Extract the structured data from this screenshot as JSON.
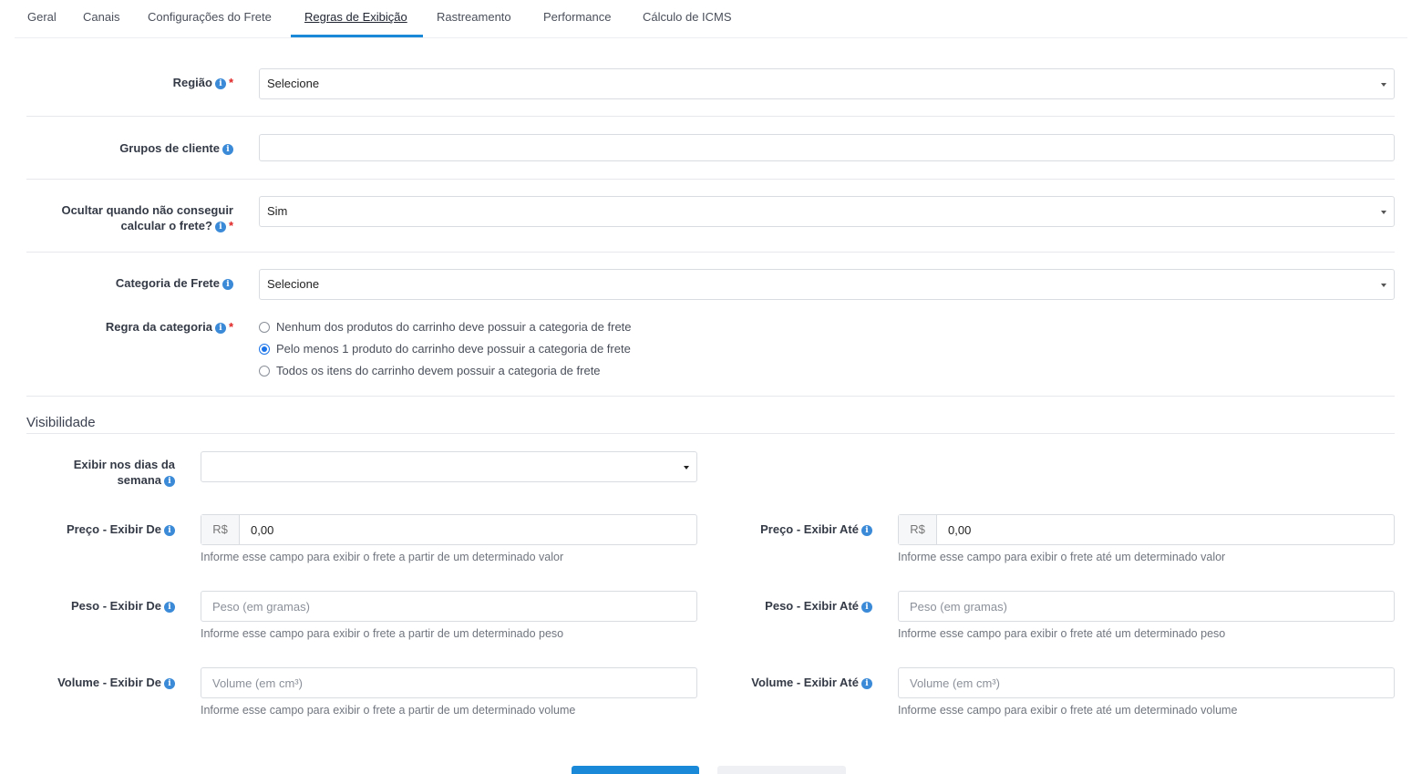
{
  "tabs": [
    {
      "label": "Geral"
    },
    {
      "label": "Canais"
    },
    {
      "label": "Configurações do Frete"
    },
    {
      "label": "Regras de Exibição"
    },
    {
      "label": "Rastreamento"
    },
    {
      "label": "Performance"
    },
    {
      "label": "Cálculo de ICMS"
    }
  ],
  "active_tab": "Regras de Exibição",
  "info_icon_glyph": "i",
  "required_mark": "*",
  "regiao": {
    "label": "Região",
    "value": "Selecione"
  },
  "grupos": {
    "label": "Grupos de cliente",
    "value": ""
  },
  "ocultar": {
    "label_line1": "Ocultar quando não conseguir",
    "label_line2": "calcular o frete?",
    "value": "Sim"
  },
  "categoria": {
    "label": "Categoria de Frete",
    "value": "Selecione"
  },
  "regra": {
    "label": "Regra da categoria",
    "options": [
      {
        "label": "Nenhum dos produtos do carrinho deve possuir a categoria de frete",
        "checked": false
      },
      {
        "label": "Pelo menos 1 produto do carrinho deve possuir a categoria de frete",
        "checked": true
      },
      {
        "label": "Todos os itens do carrinho devem possuir a categoria de frete",
        "checked": false
      }
    ]
  },
  "visibilidade": {
    "title": "Visibilidade",
    "dias": {
      "label_line1": "Exibir nos dias da",
      "label_line2": "semana",
      "value": ""
    },
    "preco_de": {
      "label": "Preço - Exibir De",
      "prefix": "R$",
      "value": "0,00",
      "help": "Informe esse campo para exibir o frete a partir de um determinado valor"
    },
    "preco_ate": {
      "label": "Preço - Exibir Até",
      "prefix": "R$",
      "value": "0,00",
      "help": "Informe esse campo para exibir o frete até um determinado valor"
    },
    "peso_de": {
      "label": "Peso - Exibir De",
      "placeholder": "Peso (em gramas)",
      "help": "Informe esse campo para exibir o frete a partir de um determinado peso"
    },
    "peso_ate": {
      "label": "Peso - Exibir Até",
      "placeholder": "Peso (em gramas)",
      "help": "Informe esse campo para exibir o frete até um determinado peso"
    },
    "volume_de": {
      "label": "Volume - Exibir De",
      "placeholder": "Volume (em cm³)",
      "help": "Informe esse campo para exibir o frete a partir de um determinado volume"
    },
    "volume_ate": {
      "label": "Volume - Exibir Até",
      "placeholder": "Volume (em cm³)",
      "help": "Informe esse campo para exibir o frete até um determinado volume"
    }
  },
  "colors": {
    "accent": "#1a8ad8",
    "required": "#e02424",
    "info": "#3a8ad8"
  }
}
